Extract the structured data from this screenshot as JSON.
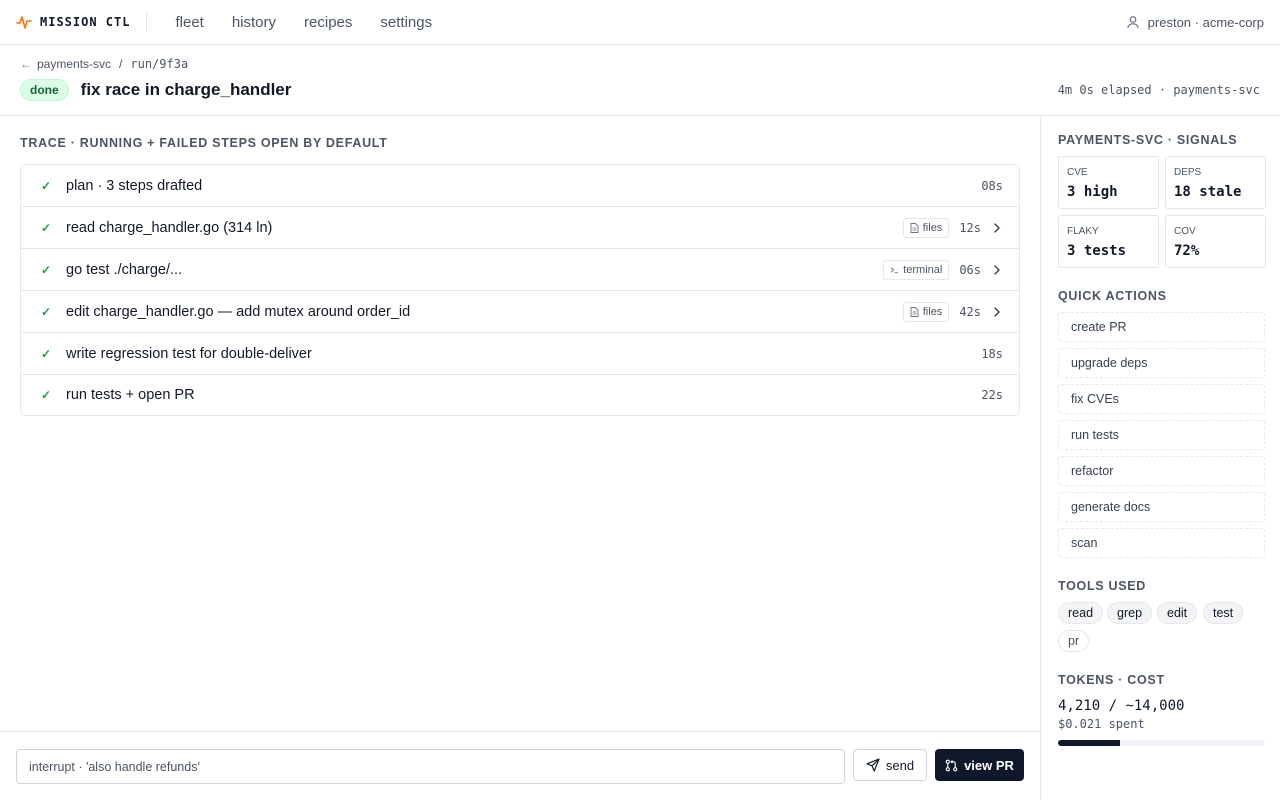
{
  "app": {
    "brand": "MISSION CTL",
    "nav": [
      "fleet",
      "history",
      "recipes",
      "settings"
    ],
    "user": "preston · acme-corp"
  },
  "header": {
    "breadcrumb_repo": "payments-svc",
    "breadcrumb_run": "run/9f3a",
    "status": "done",
    "title": "fix race in charge_handler",
    "elapsed": "4m 0s elapsed · payments-svc"
  },
  "trace": {
    "heading": "TRACE · RUNNING + FAILED STEPS OPEN BY DEFAULT",
    "steps": [
      {
        "check": "✓",
        "label": "plan · 3 steps drafted",
        "tag": null,
        "duration": "08s",
        "expandable": false
      },
      {
        "check": "✓",
        "label": "read charge_handler.go (314 ln)",
        "tag": "files",
        "duration": "12s",
        "expandable": true
      },
      {
        "check": "✓",
        "label": "go test ./charge/...",
        "tag": "terminal",
        "duration": "06s",
        "expandable": true
      },
      {
        "check": "✓",
        "label": "edit charge_handler.go — add mutex around order_id",
        "tag": "files",
        "duration": "42s",
        "expandable": true
      },
      {
        "check": "✓",
        "label": "write regression test for double-deliver",
        "tag": null,
        "duration": "18s",
        "expandable": false
      },
      {
        "check": "✓",
        "label": "run tests + open PR",
        "tag": null,
        "duration": "22s",
        "expandable": false
      }
    ]
  },
  "composer": {
    "placeholder": "interrupt · 'also handle refunds'",
    "send_label": "send",
    "view_pr_label": "view PR"
  },
  "sidebar": {
    "signals_heading": "PAYMENTS-SVC · SIGNALS",
    "signals": [
      {
        "key": "CVE",
        "value": "3 high"
      },
      {
        "key": "DEPS",
        "value": "18 stale"
      },
      {
        "key": "FLAKY",
        "value": "3 tests"
      },
      {
        "key": "COV",
        "value": "72%"
      }
    ],
    "quick_actions_heading": "QUICK ACTIONS",
    "quick_actions": [
      "create PR",
      "upgrade deps",
      "fix CVEs",
      "run tests",
      "refactor",
      "generate docs",
      "scan"
    ],
    "tools_heading": "TOOLS USED",
    "tools": [
      "read",
      "grep",
      "edit",
      "test",
      "pr"
    ],
    "tokens_heading": "TOKENS · COST",
    "tokens_text": "4,210 / ~14,000",
    "cost_text": "$0.021 spent",
    "tokens_used": 4210,
    "tokens_budget": 14000
  },
  "colors": {
    "accent": "#f97316",
    "success": "#16a34a",
    "dark_button": "#0f172a"
  }
}
